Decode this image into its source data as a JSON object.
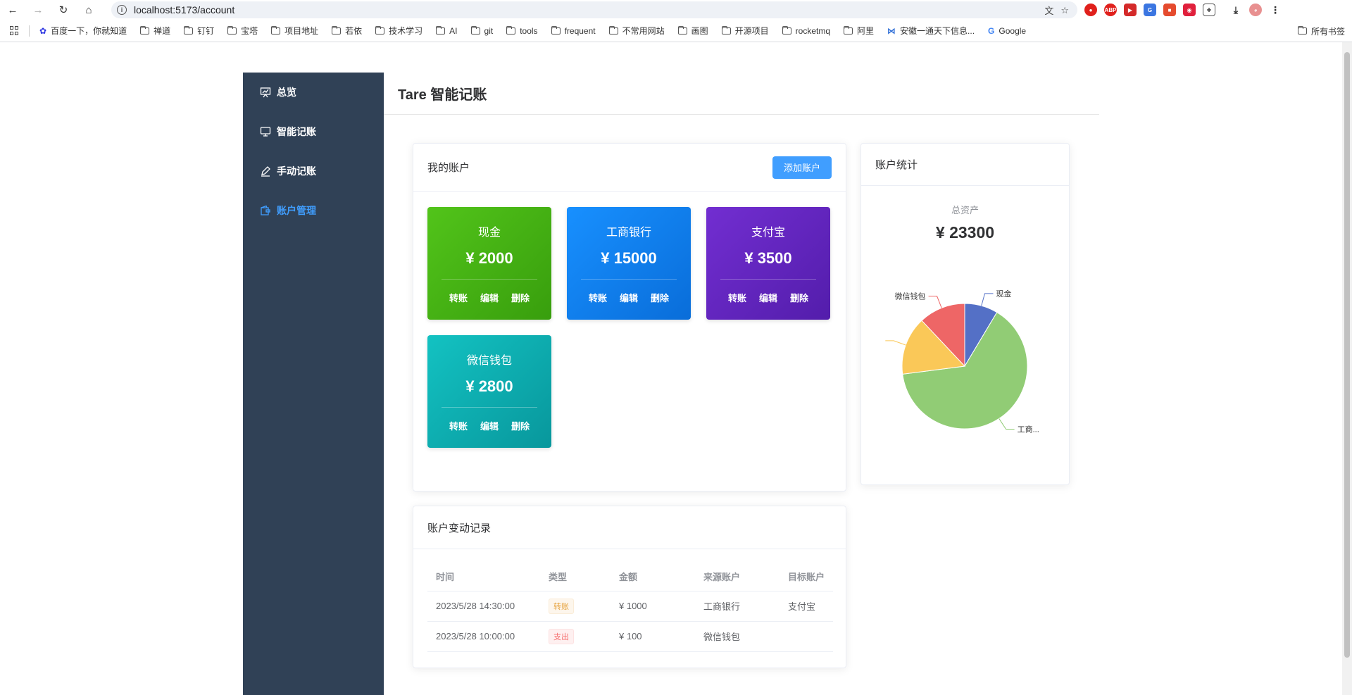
{
  "browser": {
    "url": "localhost:5173/account",
    "bookmarks": [
      "百度一下，你就知道",
      "禅道",
      "钉钉",
      "宝塔",
      "项目地址",
      "若依",
      "技术学习",
      "AI",
      "git",
      "tools",
      "frequent",
      "不常用网站",
      "画图",
      "开源项目",
      "rocketmq",
      "阿里",
      "安徽一通天下信息...",
      "Google"
    ],
    "all_bookmarks": "所有书签"
  },
  "sidebar": {
    "items": [
      {
        "label": "总览",
        "icon": "chart-icon",
        "active": false
      },
      {
        "label": "智能记账",
        "icon": "monitor-icon",
        "active": false
      },
      {
        "label": "手动记账",
        "icon": "pen-icon",
        "active": false
      },
      {
        "label": "账户管理",
        "icon": "wallet-icon",
        "active": true
      }
    ]
  },
  "header": {
    "title": "Tare 智能记账"
  },
  "accounts_card": {
    "title": "我的账户",
    "add_button": "添加账户",
    "accounts": [
      {
        "name": "现金",
        "amount": "¥ 2000",
        "color_from": "#52c41a",
        "color_to": "#389e0d"
      },
      {
        "name": "工商银行",
        "amount": "¥ 15000",
        "color_from": "#1890ff",
        "color_to": "#096dd9"
      },
      {
        "name": "支付宝",
        "amount": "¥ 3500",
        "color_from": "#722ed1",
        "color_to": "#531dab"
      },
      {
        "name": "微信钱包",
        "amount": "¥ 2800",
        "color_from": "#13c2c2",
        "color_to": "#08979c"
      }
    ],
    "ops": {
      "transfer": "转账",
      "edit": "编辑",
      "delete": "删除"
    }
  },
  "stats_card": {
    "title": "账户统计",
    "total_label": "总资产",
    "total_value": "¥ 23300"
  },
  "chart_data": {
    "type": "pie",
    "title": "",
    "slices": [
      {
        "label": "现金",
        "value": 2000,
        "color": "#5470c6"
      },
      {
        "label": "工商...",
        "value": 15000,
        "color": "#91cc75"
      },
      {
        "label": "",
        "value": 3500,
        "color": "#fac858"
      },
      {
        "label": "微信钱包",
        "value": 2800,
        "color": "#ee6666"
      }
    ]
  },
  "records_card": {
    "title": "账户变动记录",
    "columns": [
      "时间",
      "类型",
      "金额",
      "来源账户",
      "目标账户"
    ],
    "rows": [
      {
        "time": "2023/5/28 14:30:00",
        "type": "转账",
        "type_style": "warning",
        "amount": "¥ 1000",
        "from": "工商银行",
        "to": "支付宝"
      },
      {
        "time": "2023/5/28 10:00:00",
        "type": "支出",
        "type_style": "danger",
        "amount": "¥ 100",
        "from": "微信钱包",
        "to": ""
      }
    ]
  }
}
